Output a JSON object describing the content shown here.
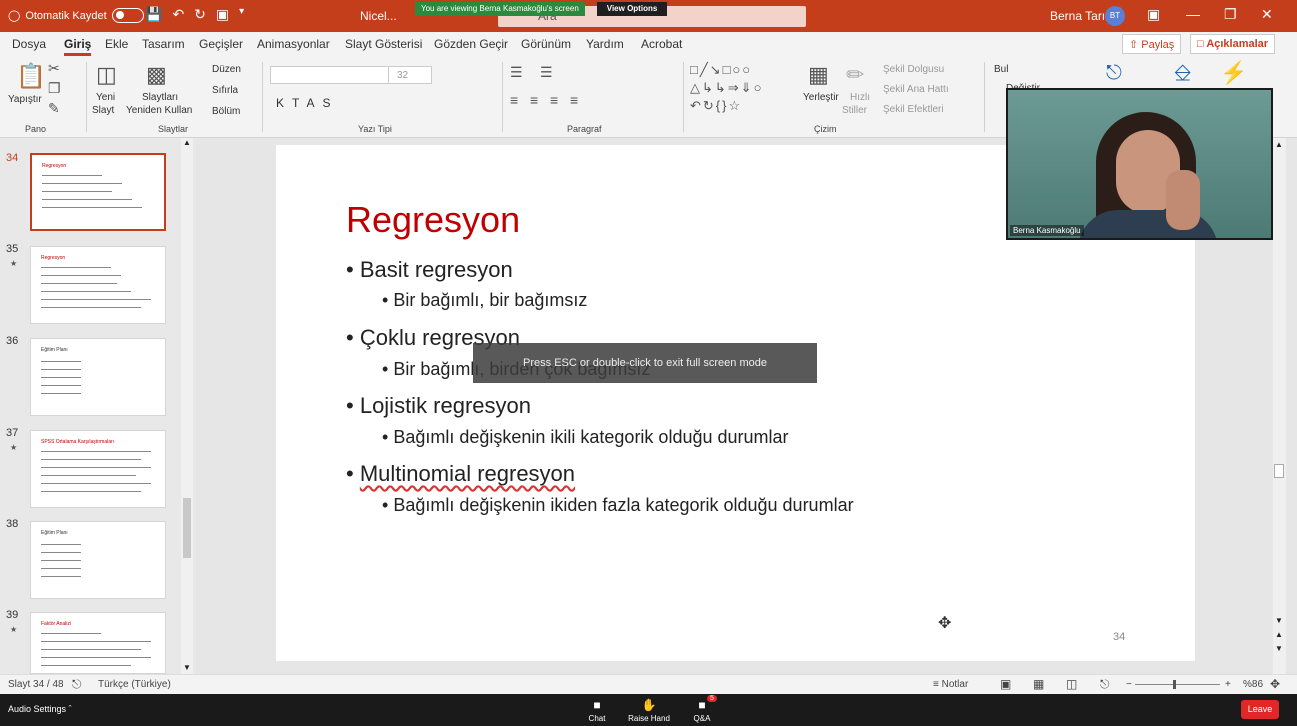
{
  "titlebar": {
    "autosave_label": "Otomatik Kaydet",
    "doc_name": "Nicel...",
    "search_placeholder": "Ara",
    "user_name": "Berna Tarı",
    "user_initials": "BT",
    "brand_color": "#c43e1c"
  },
  "zoom_banner": {
    "viewing": "You are viewing Berna Kasmakoğlu's screen",
    "view_options": "View Options"
  },
  "menu": {
    "tabs": [
      "Dosya",
      "Giriş",
      "Ekle",
      "Tasarım",
      "Geçişler",
      "Animasyonlar",
      "Slayt Gösterisi",
      "Gözden Geçir",
      "Görünüm",
      "Yardım",
      "Acrobat"
    ],
    "active": "Giriş",
    "share": "Paylaş",
    "comments": "Açıklamalar"
  },
  "ribbon": {
    "paste": "Yapıştır",
    "new_slide_1": "Yeni",
    "new_slide_2": "Slayt",
    "reuse_1": "Slaytları",
    "reuse_2": "Yeniden Kullan",
    "layout": "Düzen",
    "reset": "Sıfırla",
    "section": "Bölüm",
    "font_size": "32",
    "arrange": "Yerleştir",
    "quick_styles_1": "Hızlı",
    "quick_styles_2": "Stiller",
    "shape_fill": "Şekil Dolgusu",
    "shape_outline": "Şekil Ana Hattı",
    "shape_effects": "Şekil Efektleri",
    "find": "Bul",
    "replace": "Değiştir",
    "groups": {
      "pano": "Pano",
      "slaytlar": "Slaytlar",
      "yazi_tipi": "Yazı Tipi",
      "paragraf": "Paragraf",
      "cizim": "Çizim"
    }
  },
  "thumbnails": [
    {
      "num": "34",
      "title": "Regresyon"
    },
    {
      "num": "35",
      "title": "Regresyon"
    },
    {
      "num": "36",
      "title": "Eğitim Planı"
    },
    {
      "num": "37",
      "title": "SPSS Ortalama Karşılaştırmaları"
    },
    {
      "num": "38",
      "title": "Eğitim Planı"
    },
    {
      "num": "39",
      "title": "Faktör Analizi"
    }
  ],
  "slide": {
    "title": "Regresyon",
    "b1": "Basit regresyon",
    "s1": "Bir bağımlı, bir bağımsız",
    "b2": "Çoklu regresyon",
    "s2": "Bir bağımlı, birden çok bağımsız",
    "b3": "Lojistik regresyon",
    "s3": "Bağımlı değişkenin ikili kategorik olduğu durumlar",
    "b4": "Multinomial regresyon",
    "s4": "Bağımlı değişkenin ikiden fazla kategorik olduğu durumlar",
    "page": "34"
  },
  "overlay": {
    "esc_message": "Press ESC or double-click to exit full screen mode"
  },
  "video": {
    "participant": "Berna Kasmakoğlu"
  },
  "status": {
    "slide_counter": "Slayt 34 / 48",
    "language": "Türkçe (Türkiye)",
    "notes": "Notlar",
    "zoom": "%86"
  },
  "zoom_footer": {
    "audio": "Audio Settings",
    "chat": "Chat",
    "raise_hand": "Raise Hand",
    "qa": "Q&A",
    "qa_badge": "5",
    "leave": "Leave"
  }
}
